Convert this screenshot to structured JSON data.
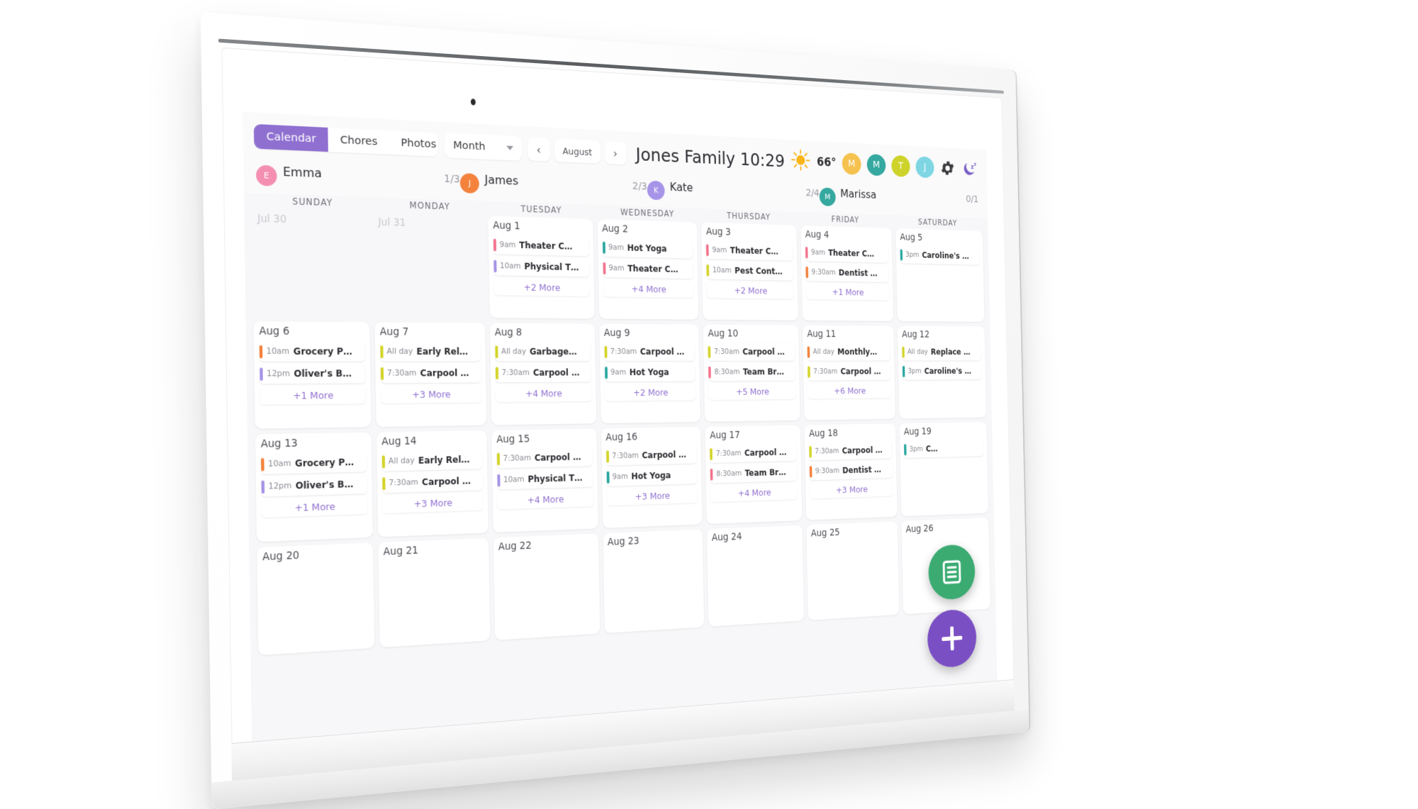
{
  "topbar": {
    "tabs": [
      {
        "label": "Calendar",
        "active": true
      },
      {
        "label": "Chores",
        "active": false
      },
      {
        "label": "Photos",
        "active": false
      }
    ],
    "view_select": "Month",
    "prev_label": "‹",
    "month_label": "August",
    "next_label": "›",
    "title": "Jones Family 10:29",
    "weather": {
      "icon": "sun-icon",
      "temperature": "66°"
    },
    "avatars": [
      {
        "initial": "M",
        "color": "#f5c24f"
      },
      {
        "initial": "M",
        "color": "#35a8a0"
      },
      {
        "initial": "T",
        "color": "#cdd32a"
      },
      {
        "initial": "J",
        "color": "#7fd6e3"
      }
    ],
    "settings_icon": "gear-icon",
    "sleep_icon": "moon-zzz-icon"
  },
  "members": [
    {
      "initial": "E",
      "name": "Emma",
      "count": "1/3",
      "color": "#f48fb1",
      "fill": "#f48fb1",
      "pct": 33
    },
    {
      "initial": "J",
      "name": "James",
      "count": "2/3",
      "color": "#f4823c",
      "fill": "#f4823c",
      "pct": 66
    },
    {
      "initial": "K",
      "name": "Kate",
      "count": "2/4",
      "color": "#a694e8",
      "fill": "#a694e8",
      "pct": 50
    },
    {
      "initial": "M",
      "name": "Marissa",
      "count": "0/1",
      "color": "#35a8a0",
      "fill": "#35a8a0",
      "pct": 0
    }
  ],
  "weekdays": [
    "SUNDAY",
    "MONDAY",
    "TUESDAY",
    "WEDNESDAY",
    "THURSDAY",
    "FRIDAY",
    "SATURDAY"
  ],
  "colors": {
    "accent_purple": "#8f6fd0",
    "fab_green": "#3bab72",
    "fab_purple": "#7b4fc4",
    "event_pink": "#f4748f",
    "event_lavender": "#a694e8",
    "event_teal": "#2aa8a0",
    "event_yellow": "#d4d42a",
    "event_orange": "#f4823c"
  },
  "days": [
    {
      "label": "Jul 30",
      "muted": true,
      "events": [],
      "more": ""
    },
    {
      "label": "Jul 31",
      "muted": true,
      "events": [],
      "more": ""
    },
    {
      "label": "Aug 1",
      "muted": false,
      "events": [
        {
          "time": "9am",
          "name": "Theater C…",
          "color": "#f4748f"
        },
        {
          "time": "10am",
          "name": "Physical T…",
          "color": "#a694e8"
        }
      ],
      "more": "+2 More"
    },
    {
      "label": "Aug 2",
      "muted": false,
      "events": [
        {
          "time": "9am",
          "name": "Hot Yoga",
          "color": "#2aa8a0"
        },
        {
          "time": "9am",
          "name": "Theater C…",
          "color": "#f4748f"
        }
      ],
      "more": "+4 More"
    },
    {
      "label": "Aug 3",
      "muted": false,
      "events": [
        {
          "time": "9am",
          "name": "Theater C…",
          "color": "#f4748f"
        },
        {
          "time": "10am",
          "name": "Pest Cont…",
          "color": "#d4d42a"
        }
      ],
      "more": "+2 More"
    },
    {
      "label": "Aug 4",
      "muted": false,
      "events": [
        {
          "time": "9am",
          "name": "Theater C…",
          "color": "#f4748f"
        },
        {
          "time": "9:30am",
          "name": "Dentist …",
          "color": "#f4823c"
        }
      ],
      "more": "+1 More"
    },
    {
      "label": "Aug 5",
      "muted": false,
      "events": [
        {
          "time": "3pm",
          "name": "Caroline's …",
          "color": "#2aa8a0"
        }
      ],
      "more": ""
    },
    {
      "label": "Aug 6",
      "muted": false,
      "events": [
        {
          "time": "10am",
          "name": "Grocery P…",
          "color": "#f4823c"
        },
        {
          "time": "12pm",
          "name": "Oliver's B…",
          "color": "#a694e8"
        }
      ],
      "more": "+1 More"
    },
    {
      "label": "Aug 7",
      "muted": false,
      "events": [
        {
          "time": "All day",
          "name": "Early Rel…",
          "color": "#d4d42a"
        },
        {
          "time": "7:30am",
          "name": "Carpool …",
          "color": "#d4d42a"
        }
      ],
      "more": "+3 More"
    },
    {
      "label": "Aug 8",
      "muted": false,
      "events": [
        {
          "time": "All day",
          "name": "Garbage…",
          "color": "#d4d42a"
        },
        {
          "time": "7:30am",
          "name": "Carpool …",
          "color": "#d4d42a"
        }
      ],
      "more": "+4 More"
    },
    {
      "label": "Aug 9",
      "muted": false,
      "events": [
        {
          "time": "7:30am",
          "name": "Carpool …",
          "color": "#d4d42a"
        },
        {
          "time": "9am",
          "name": "Hot Yoga",
          "color": "#2aa8a0"
        }
      ],
      "more": "+2 More"
    },
    {
      "label": "Aug 10",
      "muted": false,
      "events": [
        {
          "time": "7:30am",
          "name": "Carpool …",
          "color": "#d4d42a"
        },
        {
          "time": "8:30am",
          "name": "Team Br…",
          "color": "#f4748f"
        }
      ],
      "more": "+5 More"
    },
    {
      "label": "Aug 11",
      "muted": false,
      "events": [
        {
          "time": "All day",
          "name": "Monthly…",
          "color": "#f4823c"
        },
        {
          "time": "7:30am",
          "name": "Carpool …",
          "color": "#d4d42a"
        }
      ],
      "more": "+6 More"
    },
    {
      "label": "Aug 12",
      "muted": false,
      "events": [
        {
          "time": "All day",
          "name": "Replace …",
          "color": "#d4d42a"
        },
        {
          "time": "3pm",
          "name": "Caroline's …",
          "color": "#2aa8a0"
        }
      ],
      "more": ""
    },
    {
      "label": "Aug 13",
      "muted": false,
      "events": [
        {
          "time": "10am",
          "name": "Grocery P…",
          "color": "#f4823c"
        },
        {
          "time": "12pm",
          "name": "Oliver's B…",
          "color": "#a694e8"
        }
      ],
      "more": "+1 More"
    },
    {
      "label": "Aug 14",
      "muted": false,
      "events": [
        {
          "time": "All day",
          "name": "Early Rel…",
          "color": "#d4d42a"
        },
        {
          "time": "7:30am",
          "name": "Carpool …",
          "color": "#d4d42a"
        }
      ],
      "more": "+3 More"
    },
    {
      "label": "Aug 15",
      "muted": false,
      "events": [
        {
          "time": "7:30am",
          "name": "Carpool …",
          "color": "#d4d42a"
        },
        {
          "time": "10am",
          "name": "Physical T…",
          "color": "#a694e8"
        }
      ],
      "more": "+4 More"
    },
    {
      "label": "Aug 16",
      "muted": false,
      "events": [
        {
          "time": "7:30am",
          "name": "Carpool …",
          "color": "#d4d42a"
        },
        {
          "time": "9am",
          "name": "Hot Yoga",
          "color": "#2aa8a0"
        }
      ],
      "more": "+3 More"
    },
    {
      "label": "Aug 17",
      "muted": false,
      "events": [
        {
          "time": "7:30am",
          "name": "Carpool …",
          "color": "#d4d42a"
        },
        {
          "time": "8:30am",
          "name": "Team Br…",
          "color": "#f4748f"
        }
      ],
      "more": "+4 More"
    },
    {
      "label": "Aug 18",
      "muted": false,
      "events": [
        {
          "time": "7:30am",
          "name": "Carpool …",
          "color": "#d4d42a"
        },
        {
          "time": "9:30am",
          "name": "Dentist …",
          "color": "#f4823c"
        }
      ],
      "more": "+3 More"
    },
    {
      "label": "Aug 19",
      "muted": false,
      "events": [
        {
          "time": "3pm",
          "name": "C…",
          "color": "#2aa8a0"
        }
      ],
      "more": ""
    },
    {
      "label": "Aug 20",
      "muted": false,
      "events": [],
      "more": ""
    },
    {
      "label": "Aug 21",
      "muted": false,
      "events": [],
      "more": ""
    },
    {
      "label": "Aug 22",
      "muted": false,
      "events": [],
      "more": ""
    },
    {
      "label": "Aug 23",
      "muted": false,
      "events": [],
      "more": ""
    },
    {
      "label": "Aug 24",
      "muted": false,
      "events": [],
      "more": ""
    },
    {
      "label": "Aug 25",
      "muted": false,
      "events": [],
      "more": ""
    },
    {
      "label": "Aug 26",
      "muted": false,
      "events": [],
      "more": ""
    }
  ],
  "fabs": {
    "list_icon": "list-document-icon",
    "add_icon": "plus-icon"
  }
}
